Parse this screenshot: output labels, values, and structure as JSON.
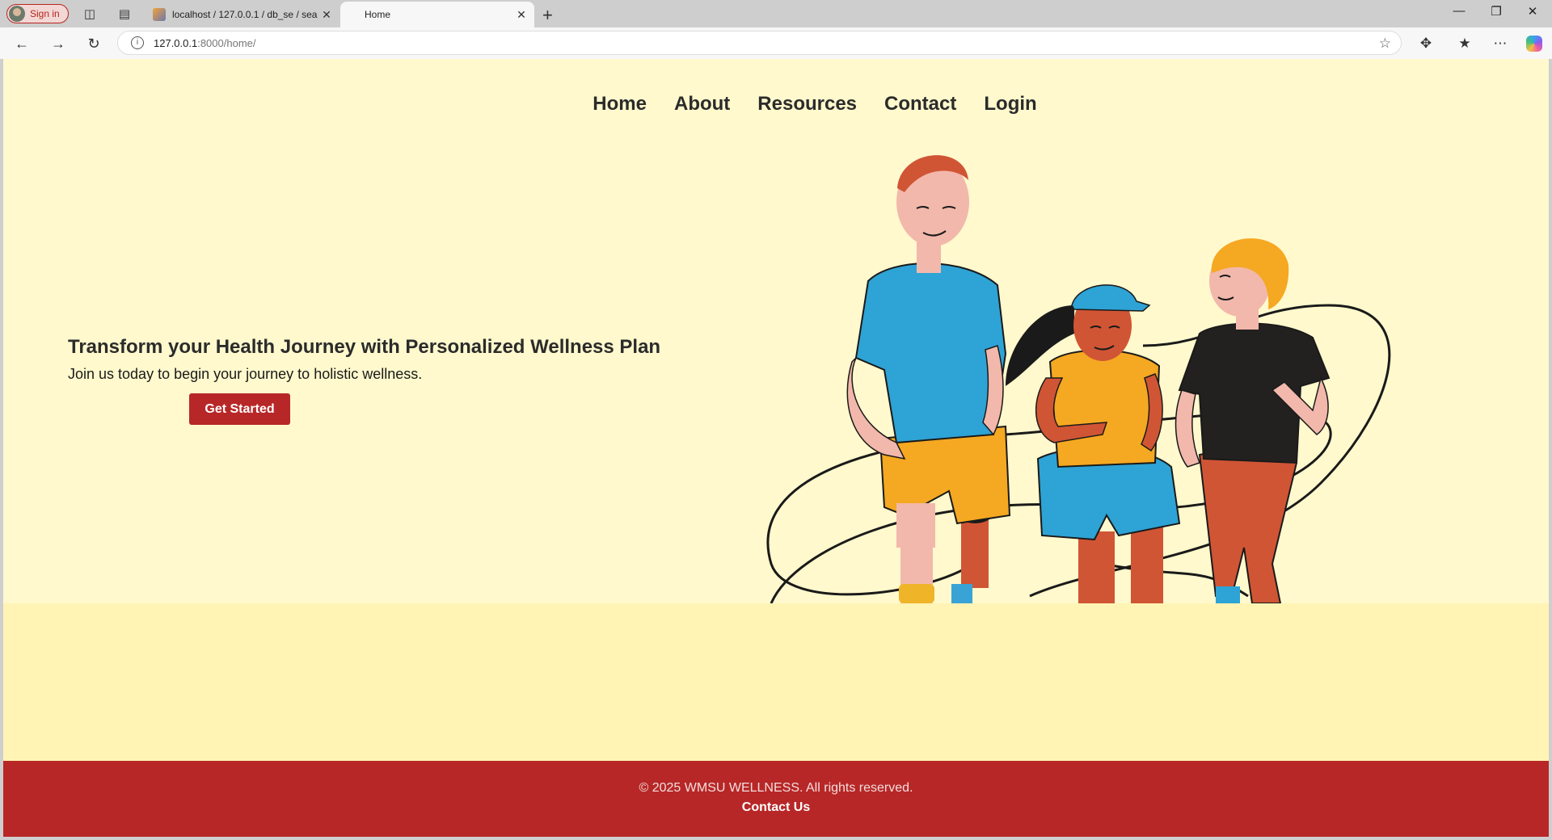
{
  "browser": {
    "signin_label": "Sign in",
    "tabs": [
      {
        "title": "localhost / 127.0.0.1 / db_se / sea",
        "active": false
      },
      {
        "title": "Home",
        "active": true
      }
    ],
    "url_host": "127.0.0.1",
    "url_path": ":8000/home/"
  },
  "nav": {
    "items": [
      "Home",
      "About",
      "Resources",
      "Contact",
      "Login"
    ]
  },
  "hero": {
    "heading": "Transform your Health Journey with Personalized Wellness Plan",
    "subtext": "Join us today to begin your journey to holistic wellness.",
    "cta_label": "Get Started"
  },
  "footer": {
    "copyright": "© 2025 WMSU WELLNESS. All rights reserved.",
    "contact_label": "Contact Us"
  },
  "colors": {
    "page_bg": "#fff9cd",
    "band_bg": "#fff4b4",
    "accent_red": "#b82727",
    "nav_text": "#2b2b2b"
  }
}
